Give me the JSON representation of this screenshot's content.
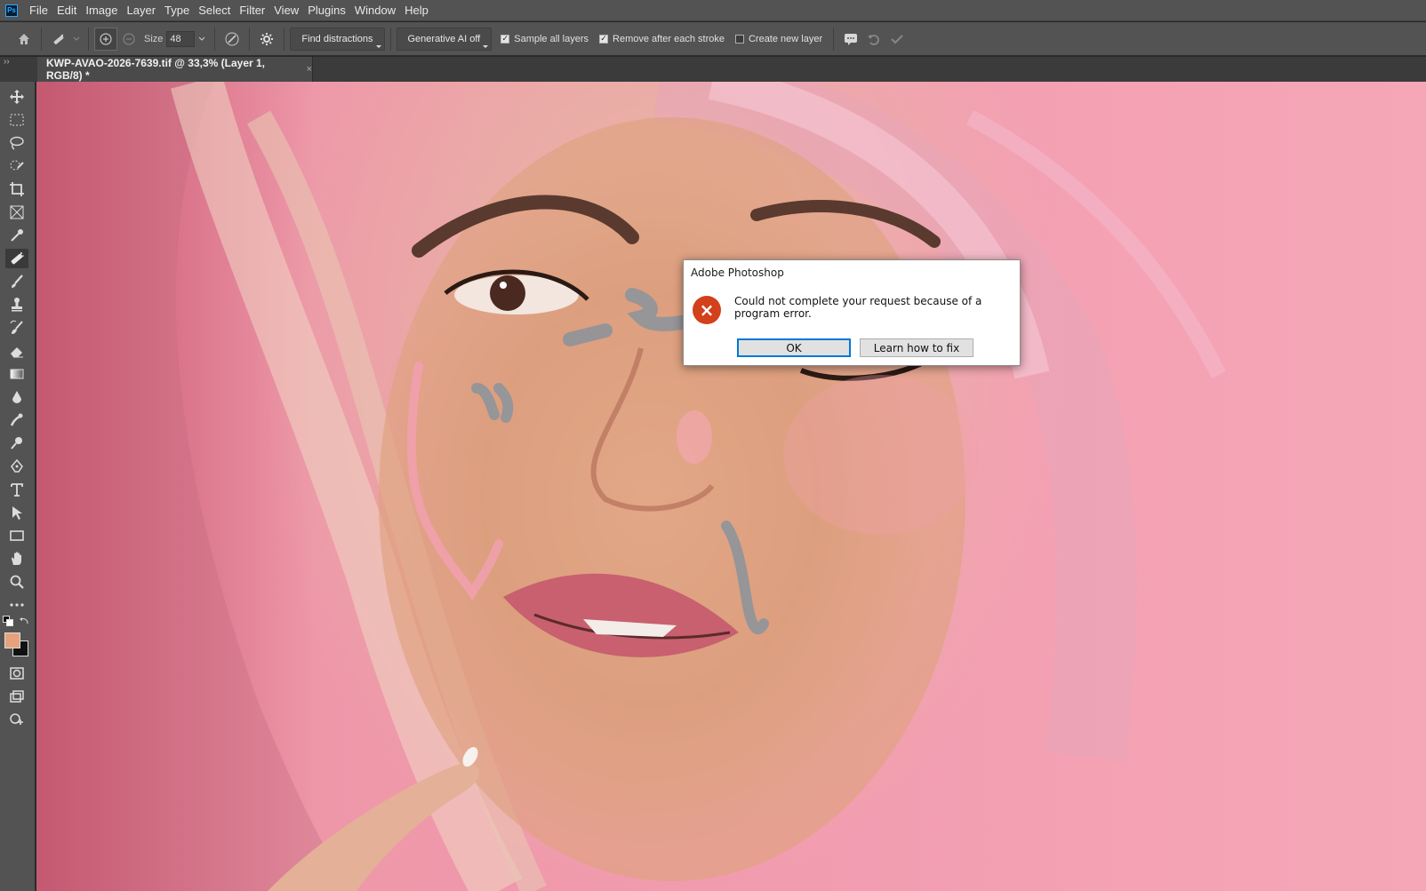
{
  "app": {
    "logo_text": "Ps"
  },
  "menu": [
    "File",
    "Edit",
    "Image",
    "Layer",
    "Type",
    "Select",
    "Filter",
    "View",
    "Plugins",
    "Window",
    "Help"
  ],
  "options": {
    "size_label": "Size",
    "size_value": "48",
    "find_distractions": "Find distractions",
    "generative_ai": "Generative AI off",
    "sample_all_layers": {
      "label": "Sample all layers",
      "checked": true
    },
    "remove_after_stroke": {
      "label": "Remove after each stroke",
      "checked": true
    },
    "create_new_layer": {
      "label": "Create new layer",
      "checked": false
    }
  },
  "tab": {
    "collapse": "››",
    "title": "KWP-AVAO-2026-7639.tif @ 33,3% (Layer 1, RGB/8) *",
    "close": "×"
  },
  "toolbar": {
    "tools": [
      "move-tool",
      "marquee-tool",
      "lasso-tool",
      "quick-selection-tool",
      "crop-tool",
      "frame-tool",
      "eyedropper-tool",
      "remove-tool",
      "brush-tool",
      "clone-stamp-tool",
      "history-brush-tool",
      "eraser-tool",
      "gradient-tool",
      "blur-tool",
      "smudge-tool",
      "dodge-tool",
      "pen-tool",
      "type-tool",
      "path-selection-tool",
      "rectangle-tool",
      "hand-tool",
      "zoom-tool",
      "more-tools"
    ],
    "active_tool": "remove-tool",
    "foreground_color": "#e6a27c",
    "background_color": "#111111"
  },
  "dialog": {
    "title": "Adobe Photoshop",
    "message": "Could not complete your request because of a program error.",
    "ok": "OK",
    "learn": "Learn how to fix",
    "icon": "×"
  }
}
